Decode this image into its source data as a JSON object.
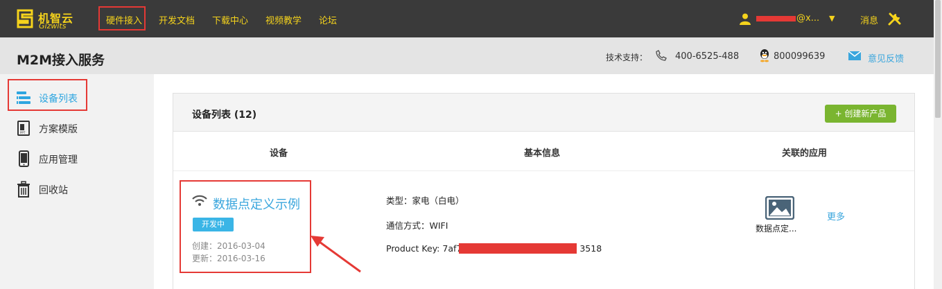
{
  "brand": {
    "name_cn": "机智云",
    "name_en": "Gizwits",
    "color": "#f5d31c"
  },
  "nav": {
    "items": [
      {
        "label": "硬件接入",
        "active": true
      },
      {
        "label": "开发文档"
      },
      {
        "label": "下载中心"
      },
      {
        "label": "视频教学"
      },
      {
        "label": "论坛"
      }
    ],
    "user": {
      "email_suffix": "@x...",
      "icon": "user-icon"
    },
    "messages_label": "消息",
    "settings_icon": "tools-icon"
  },
  "subheader": {
    "title": "M2M接入服务",
    "support_label": "技术支持：",
    "phone": "400-6525-488",
    "qq": "800099639",
    "feedback": "意见反馈"
  },
  "sidebar": {
    "items": [
      {
        "label": "设备列表",
        "icon": "device-list-icon",
        "active": true
      },
      {
        "label": "方案模版",
        "icon": "template-icon"
      },
      {
        "label": "应用管理",
        "icon": "phone-app-icon"
      },
      {
        "label": "回收站",
        "icon": "trash-icon"
      }
    ]
  },
  "panel": {
    "title": "设备列表 (12)",
    "create_button": "+ 创建新产品",
    "columns": [
      "设备",
      "基本信息",
      "关联的应用"
    ],
    "device": {
      "name": "数据点定义示例",
      "status": "开发中",
      "created": "创建：2016-03-04",
      "updated": "更新：2016-03-16",
      "type": "类型：家电（白电）",
      "comm": "通信方式：WIFI",
      "product_key_prefix": "Product Key: 7af7",
      "product_key_suffix": "3518",
      "app_name": "数据点定...",
      "more": "更多"
    }
  },
  "colors": {
    "accent_blue": "#3aa6dd",
    "create_green": "#7ab530",
    "highlight_red": "#e53935"
  }
}
